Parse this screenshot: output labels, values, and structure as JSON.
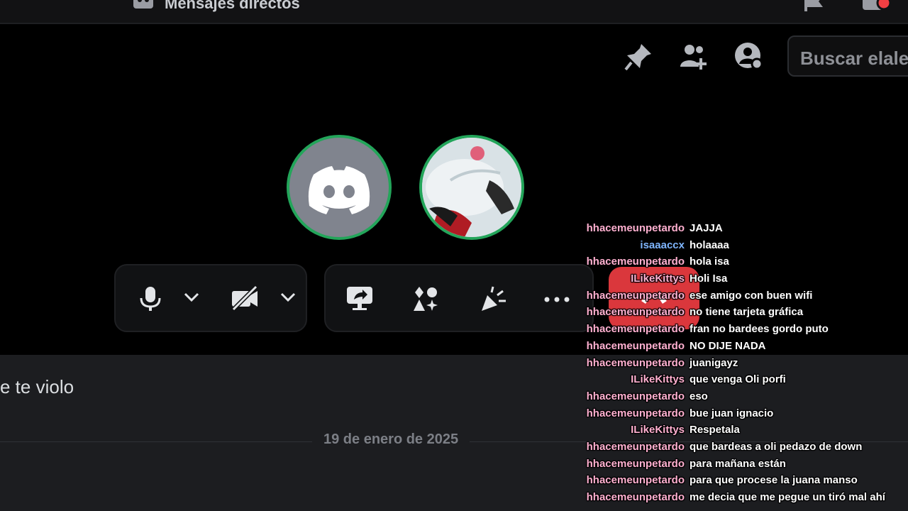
{
  "topbar": {
    "title": "Mensajes directos",
    "dm_icon": "friends-icon",
    "flag_icon": "flag-icon",
    "inbox_icon": "inbox-icon"
  },
  "header": {
    "icons": [
      "pin-icon",
      "add-friend-icon",
      "user-profile-icon"
    ],
    "search_placeholder": "Buscar elalex"
  },
  "call": {
    "participants": [
      {
        "type": "discord-default-avatar",
        "speaking": true
      },
      {
        "type": "photo-avatar",
        "speaking": true
      }
    ],
    "controls_left": [
      "microphone-icon",
      "chevron-down-icon",
      "camera-off-icon",
      "chevron-down-icon"
    ],
    "controls_right": [
      "screen-share-icon",
      "activities-icon",
      "soundboard-icon",
      "more-icon"
    ],
    "hangup": "hangup-icon"
  },
  "chat": {
    "message_fragment": "e te violo",
    "date_divider": "19 de enero de 2025"
  },
  "overlay_chat": [
    {
      "user": "hhacemeunpetardo",
      "color": "#ffb0d0",
      "text": "JAJJA"
    },
    {
      "user": "isaaaccx",
      "color": "#7fb6ff",
      "text": "holaaaa"
    },
    {
      "user": "hhacemeunpetardo",
      "color": "#ffb0d0",
      "text": "hola isa"
    },
    {
      "user": "ILikeKittys",
      "color": "#ffb0d0",
      "text": "Holi Isa"
    },
    {
      "user": "hhacemeunpetardo",
      "color": "#ffb0d0",
      "text": "ese amigo con buen wifi"
    },
    {
      "user": "hhacemeunpetardo",
      "color": "#ffb0d0",
      "text": "no tiene tarjeta gráfica"
    },
    {
      "user": "hhacemeunpetardo",
      "color": "#ffb0d0",
      "text": "fran no bardees gordo puto"
    },
    {
      "user": "hhacemeunpetardo",
      "color": "#ffb0d0",
      "text": "NO DIJE NADA"
    },
    {
      "user": "hhacemeunpetardo",
      "color": "#ffb0d0",
      "text": "juanigayz"
    },
    {
      "user": "ILikeKittys",
      "color": "#ffb0d0",
      "text": "que venga Oli porfi"
    },
    {
      "user": "hhacemeunpetardo",
      "color": "#ffb0d0",
      "text": "eso"
    },
    {
      "user": "hhacemeunpetardo",
      "color": "#ffb0d0",
      "text": "bue juan ignacio"
    },
    {
      "user": "ILikeKittys",
      "color": "#ffb0d0",
      "text": "Respetala"
    },
    {
      "user": "hhacemeunpetardo",
      "color": "#ffb0d0",
      "text": "que bardeas a oli pedazo de down"
    },
    {
      "user": "hhacemeunpetardo",
      "color": "#ffb0d0",
      "text": "para mañana están"
    },
    {
      "user": "hhacemeunpetardo",
      "color": "#ffb0d0",
      "text": "para que procese la juana manso"
    },
    {
      "user": "hhacemeunpetardo",
      "color": "#ffb0d0",
      "text": "me decia que me pegue un tiró mal ahí"
    }
  ]
}
